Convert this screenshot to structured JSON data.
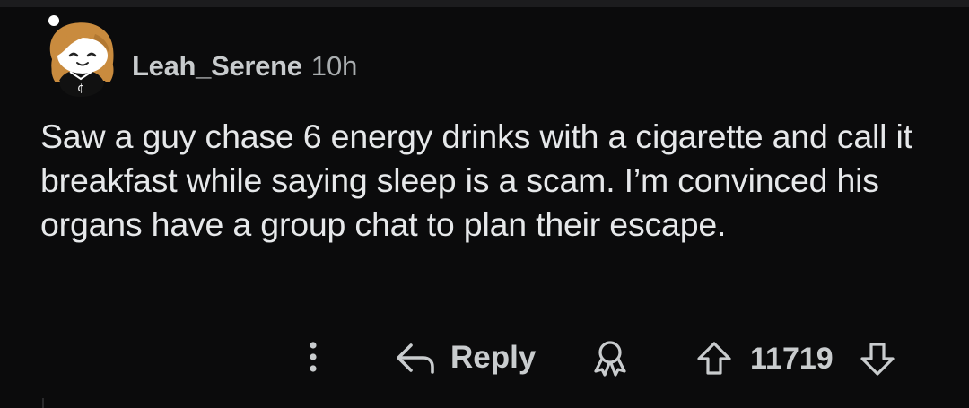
{
  "comment": {
    "username": "Leah_Serene",
    "timestamp": "10h",
    "avatar_icon": "snoo-avatar-icon",
    "body": "Saw a guy chase 6 energy drinks with a cigarette and call it breakfast while saying sleep is a scam. I’m convinced his organs have a group chat to plan their escape."
  },
  "actions": {
    "more_icon": "more-vertical-icon",
    "reply_icon": "reply-arrow-icon",
    "reply_label": "Reply",
    "award_icon": "award-icon",
    "upvote_icon": "upvote-arrow-icon",
    "vote_count": "11719",
    "downvote_icon": "downvote-arrow-icon"
  },
  "colors": {
    "background": "#0b0b0c",
    "text": "#e6e8ea",
    "muted": "#a9adaf",
    "icon": "#c9ccce"
  }
}
